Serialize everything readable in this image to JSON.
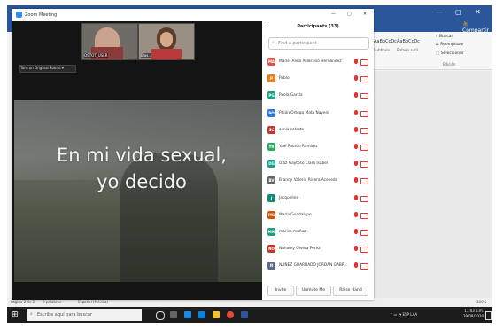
{
  "zoom": {
    "title": "Zoom Meeting",
    "window_controls": [
      "—",
      "▢",
      "✕"
    ],
    "thumbnails": [
      {
        "label": "OSTOT_USER"
      },
      {
        "label": "Blas..."
      }
    ],
    "audio_button": "Turn on Original Sound",
    "video_overlay": {
      "line1": "En mi vida sexual,",
      "line2": "yo decido"
    }
  },
  "participants": {
    "title": "Participants (33)",
    "search_placeholder": "Find a participant",
    "items": [
      {
        "initials": "MA",
        "name": "Mariel Alina Palestino Hernández",
        "color": "#d9534f"
      },
      {
        "initials": "P",
        "name": "Pablo",
        "color": "#e67e22"
      },
      {
        "initials": "PG",
        "name": "Paola García",
        "color": "#16a085"
      },
      {
        "initials": "PO",
        "name": "Pitión Ortega Mata Nayeni",
        "color": "#2c7be5"
      },
      {
        "initials": "SC",
        "name": "sonia celeste",
        "color": "#c0392b"
      },
      {
        "initials": "YR",
        "name": "Yael Padrón Ramírez",
        "color": "#27ae60"
      },
      {
        "initials": "DG",
        "name": "Díaz Gaytoso Clara Isabel",
        "color": "#16a085"
      },
      {
        "initials": "BV",
        "name": "Brandy Valeria Rivera Acevedo",
        "color": "#666666"
      },
      {
        "initials": "J",
        "name": "Jacqueline",
        "color": "#138d75"
      },
      {
        "initials": "MG",
        "name": "María Guadalupe",
        "color": "#d35400"
      },
      {
        "initials": "MM",
        "name": "marisa muñoz",
        "color": "#16a085"
      },
      {
        "initials": "NO",
        "name": "Nahomy Olvera Pérez",
        "color": "#c0392b"
      },
      {
        "initials": "N",
        "name": "NUÑEZ GUARDADO JORDAN GABR...",
        "color": "#5b6c8a"
      }
    ],
    "buttons": {
      "invite": "Invite",
      "unmute": "Unmute Me",
      "raise": "Raise Hand"
    }
  },
  "word": {
    "share": "Compartir",
    "ribbon": {
      "styles": [
        "AaBbCcDc",
        "AaBbCcDc"
      ],
      "style_labels": [
        "Subtítulo",
        "Énfasis sutil"
      ],
      "buscar": "Buscar",
      "reemplazar": "Reemplazar",
      "seleccionar": "Seleccionar",
      "edicion": "Edición"
    },
    "status": {
      "page": "Página 2 de 2",
      "words": "0 palabras",
      "lang": "Español (México)",
      "zoom": "100%"
    }
  },
  "taskbar": {
    "search_placeholder": "Escribe aquí para buscar",
    "lang": "ESP",
    "lang2": "LAA",
    "time": "11:03 a.m.",
    "date": "29/09/2020"
  }
}
